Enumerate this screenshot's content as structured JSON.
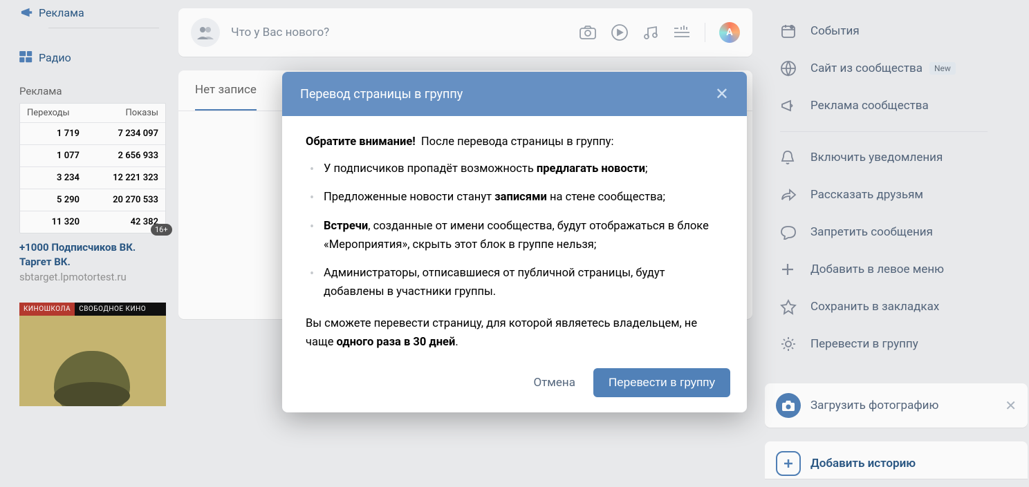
{
  "leftNav": {
    "ads": "Реклама",
    "radio": "Радио"
  },
  "leftAd": {
    "title": "Реклама",
    "col1": "Переходы",
    "col2": "Показы",
    "rows": [
      {
        "a": "1 719",
        "b": "7 234 097"
      },
      {
        "a": "1 077",
        "b": "2 656 933"
      },
      {
        "a": "3 234",
        "b": "12 221 323"
      },
      {
        "a": "5 290",
        "b": "20 270 533"
      },
      {
        "a": "11 320",
        "b": "42 382"
      }
    ],
    "ageBadge": "16+",
    "link1": "+1000 Подписчиков ВК.",
    "link2": "Таргет ВК.",
    "domain": "sbtarget.lpmotortest.ru",
    "bannerL": "КИНОШКОЛА",
    "bannerR": "СВОБОДНОЕ КИНО"
  },
  "composer": {
    "placeholder": "Что у Вас нового?",
    "accentLetter": "A"
  },
  "tabs": {
    "noPosts": "Нет записе"
  },
  "rightMenu": {
    "events": "События",
    "site": "Сайт из сообщества",
    "siteBadge": "New",
    "adv": "Реклама сообщества",
    "notif": "Включить уведомления",
    "share": "Рассказать друзьям",
    "msg": "Запретить сообщения",
    "addLeft": "Добавить в левое меню",
    "bookmark": "Сохранить в закладках",
    "convert": "Перевести в группу",
    "upload": "Загрузить фотографию",
    "story": "Добавить историю"
  },
  "modal": {
    "title": "Перевод страницы в группу",
    "leadStrong": "Обратите внимание!",
    "leadRest": "После перевода страницы в группу:",
    "b1a": "У подписчиков пропадёт возможность ",
    "b1b": "предлагать новости",
    "b1c": ";",
    "b2a": "Предложенные новости станут ",
    "b2b": "записями",
    "b2c": " на стене сообщества;",
    "b3a": "Встречи",
    "b3b": ", созданные от имени сообщества, будут отображаться в блоке «Мероприятия», скрыть этот блок в группе нельзя;",
    "b4": "Администраторы, отписавшиеся от публичной страницы, будут добавлены в участники группы.",
    "footA": "Вы сможете перевести страницу, для которой являетесь владельцем, не чаще ",
    "footB": "одного раза в 30 дней",
    "footC": ".",
    "cancel": "Отмена",
    "ok": "Перевести в группу"
  }
}
